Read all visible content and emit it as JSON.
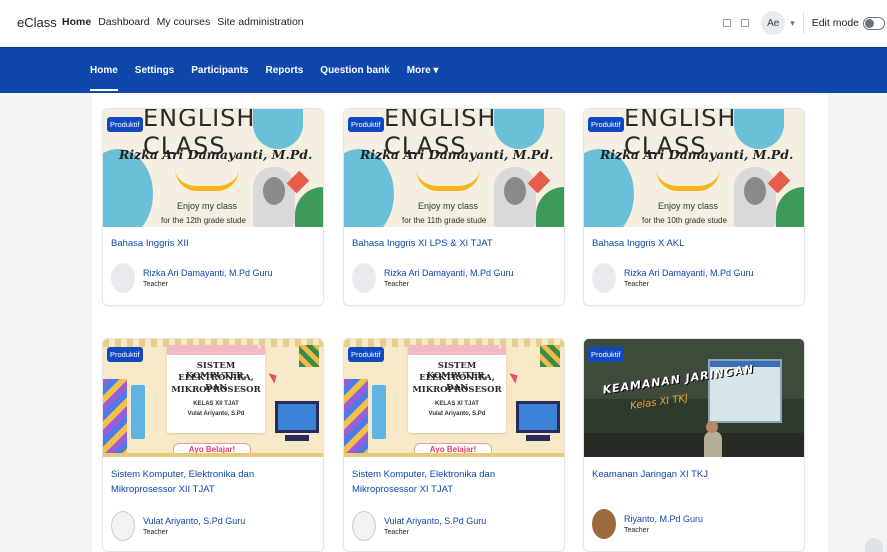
{
  "brand": "eClass",
  "primary_nav": [
    "Home",
    "Dashboard",
    "My courses",
    "Site administration"
  ],
  "header": {
    "avatar_initials": "Ae",
    "caret": "▾",
    "edit_mode_label": "Edit mode"
  },
  "secondary_nav": [
    "Home",
    "Settings",
    "Participants",
    "Reports",
    "Question bank",
    "More ▾"
  ],
  "courses": [
    {
      "badge": "Produktif",
      "title": "Bahasa Inggris XII",
      "teacher": "Rizka Ari Damayanti, M.Pd Guru",
      "role": "Teacher",
      "image": {
        "heading": "ENGLISH CLASS",
        "name": "Rizka Ari Damayanti, M.Pd.",
        "enjoy": "Enjoy my class",
        "for": "for the 12th grade stude"
      }
    },
    {
      "badge": "Produktif",
      "title": "Bahasa Inggris XI LPS & XI TJAT",
      "teacher": "Rizka Ari Damayanti, M.Pd Guru",
      "role": "Teacher",
      "image": {
        "heading": "ENGLISH CLASS",
        "name": "Rizka Ari Damayanti, M.Pd.",
        "enjoy": "Enjoy my class",
        "for": "for the 11th grade stude"
      }
    },
    {
      "badge": "Produktif",
      "title": "Bahasa Inggris X AKL",
      "teacher": "Rizka Ari Damayanti, M.Pd Guru",
      "role": "Teacher",
      "image": {
        "heading": "ENGLISH CLASS",
        "name": "Rizka Ari Damayanti, M.Pd.",
        "enjoy": "Enjoy my class",
        "for": "for the 10th grade stude"
      }
    },
    {
      "badge": "Produktif",
      "title": "Sistem Komputer, Elektronika dan Mikroprosessor XII TJAT",
      "teacher": "Vulat Ariyanto, S.Pd Guru",
      "role": "Teacher",
      "image": {
        "line1": "SISTEM KOMPUTER,",
        "line2": "ELEKTRONIKA, DAN",
        "line3": "MIKROPROSESOR",
        "kelas": "KELAS XII TJAT",
        "guru": "Vulat Ariyanto, S.Pd",
        "cta": "Ayo Belajar!"
      }
    },
    {
      "badge": "Produktif",
      "title": "Sistem Komputer, Elektronika dan Mikroprosessor XI TJAT",
      "teacher": "Vulat Ariyanto, S.Pd Guru",
      "role": "Teacher",
      "image": {
        "line1": "SISTEM KOMPUTER,",
        "line2": "ELEKTRONIKA, DAN",
        "line3": "MIKROPROSESOR",
        "kelas": "KELAS XI TJAT",
        "guru": "Vulat Ariyanto, S.Pd",
        "cta": "Ayo Belajar!"
      }
    },
    {
      "badge": "Produktif",
      "title": "Keamanan Jaringan XI TKJ",
      "teacher": "Riyanto, M.Pd Guru",
      "role": "Teacher",
      "image": {
        "heading": "KEAMANAN JARINGAN",
        "sub": "Kelas XI TKJ"
      }
    }
  ]
}
